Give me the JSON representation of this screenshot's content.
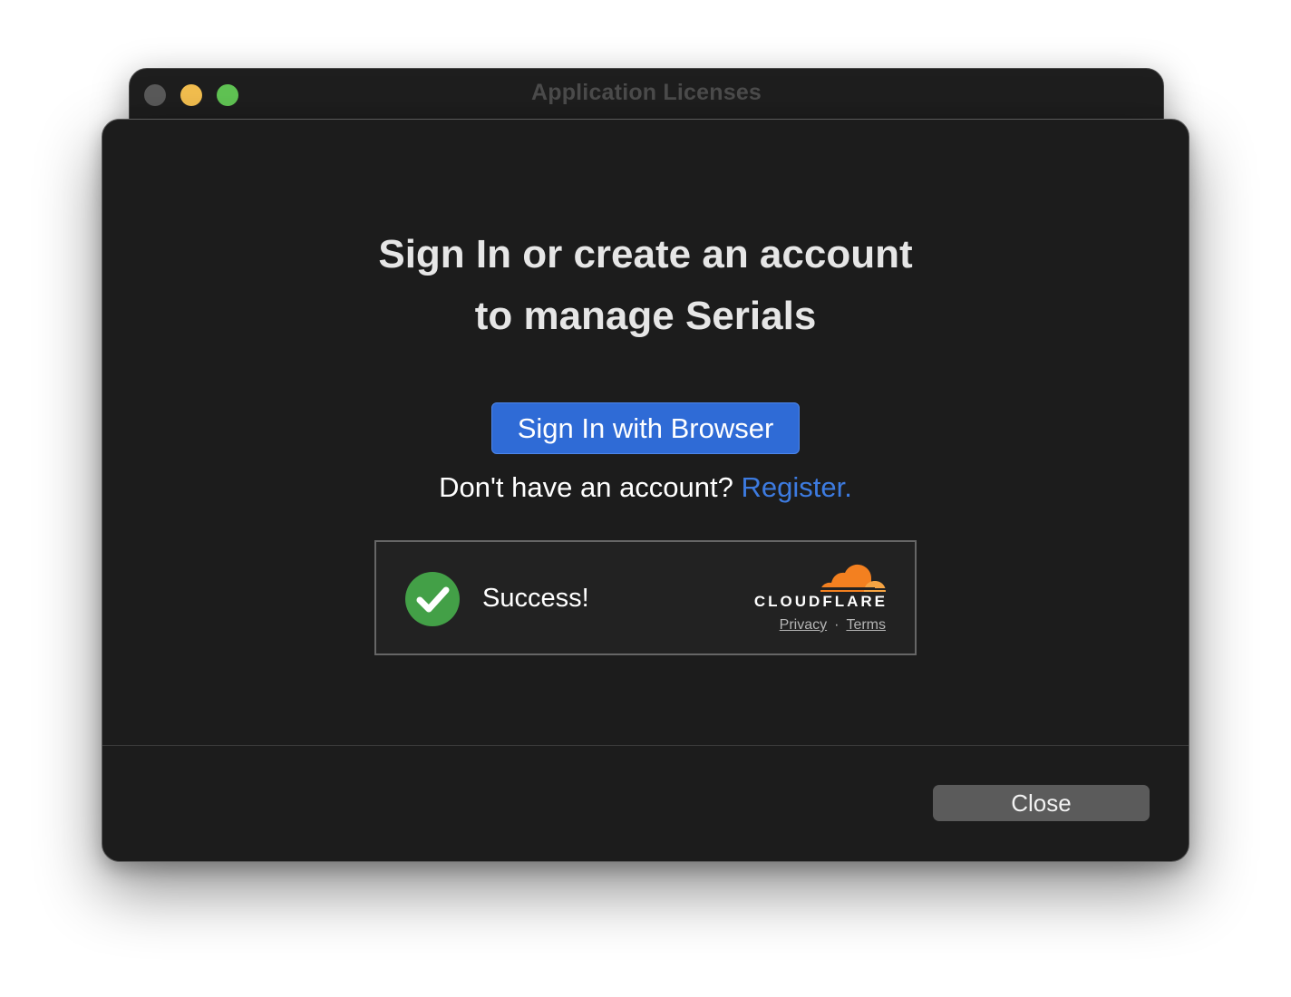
{
  "window": {
    "title": "Application Licenses"
  },
  "sheet": {
    "heading_line1": "Sign In or create an account",
    "heading_line2": "to manage Serials",
    "signin_button_label": "Sign In with Browser",
    "register_prompt": "Don't have an account?",
    "register_link": "Register.",
    "close_button_label": "Close"
  },
  "captcha": {
    "status_text": "Success!",
    "brand": "CLOUDFLARE",
    "privacy_link": "Privacy",
    "separator": "·",
    "terms_link": "Terms",
    "status_color": "#43a047",
    "brand_color": "#f38020"
  },
  "colors": {
    "accent_blue": "#2f6bd6",
    "link_blue": "#3d7be0",
    "sheet_background": "#1c1c1c"
  }
}
